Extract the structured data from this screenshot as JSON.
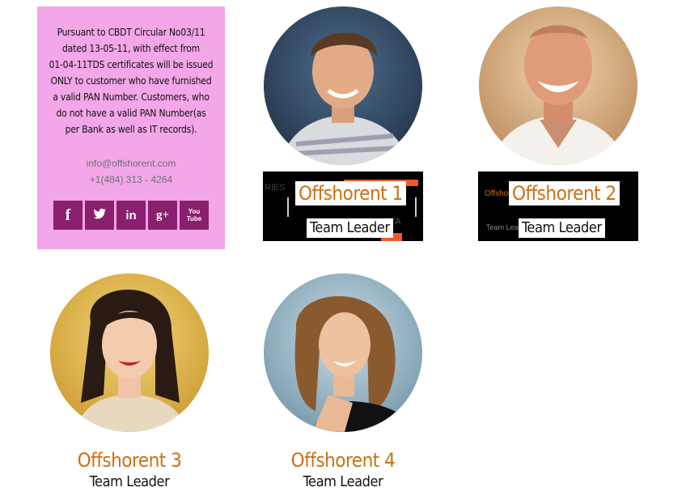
{
  "notice": {
    "lines": [
      "Pursuant to CBDT Circular No03/11",
      "dated 13-05-11, with effect from",
      "01-04-11TDS certificates will be issued",
      "ONLY to customer who have furnished",
      "a valid PAN Number. Customers, who",
      "do not have a valid PAN Number(as",
      "per Bank as well as IT records)."
    ],
    "email": "info@offshorent.com",
    "phone": "+1(484) 313 - 4264",
    "social": [
      {
        "icon": "facebook-icon",
        "glyph": "f"
      },
      {
        "icon": "twitter-icon",
        "glyph": ""
      },
      {
        "icon": "linkedin-icon",
        "glyph": "in"
      },
      {
        "icon": "google-plus-icon",
        "glyph": "g+"
      },
      {
        "icon": "youtube-icon",
        "glyph": "You Tube"
      }
    ]
  },
  "members": [
    {
      "name": "Offshorent 1",
      "role": "Team Leader"
    },
    {
      "name": "Offshorent 2",
      "role": "Team Leader"
    },
    {
      "name": "Offshorent 3",
      "role": "Team Leader"
    },
    {
      "name": "Offshorent 4",
      "role": "Team Leader"
    }
  ],
  "banner_fragments": {
    "m1_left": "RIES",
    "m1_right": "ETA",
    "m2_left": "Offshorent",
    "m2_small": "Team Lead..."
  },
  "colors": {
    "notice_bg": "#f3a6e8",
    "social_bg": "#8a1f6f",
    "name": "#cf6f10"
  }
}
